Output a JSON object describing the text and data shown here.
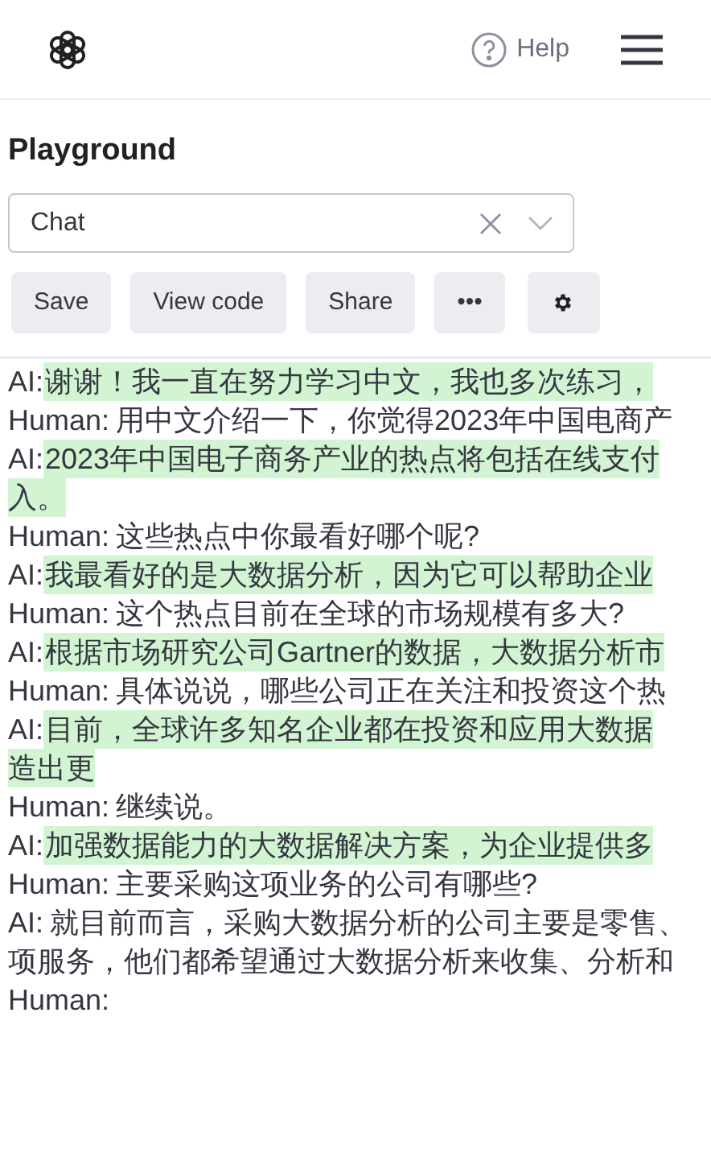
{
  "header": {
    "help": "Help"
  },
  "title": "Playground",
  "mode_select": {
    "value": "Chat"
  },
  "toolbar": [
    {
      "kind": "text",
      "label": "Save"
    },
    {
      "kind": "text",
      "label": "View code"
    },
    {
      "kind": "text",
      "label": "Share"
    },
    {
      "kind": "text",
      "label": "•••"
    },
    {
      "kind": "settings"
    }
  ],
  "messages": [
    {
      "speaker": "AI:",
      "highlighted": true,
      "lines": [
        "谢谢！我一直在努力学习中文，我也多次练习，"
      ]
    },
    {
      "speaker": "Human:",
      "highlighted": false,
      "lines": [
        "用中文介绍一下，你觉得2023年中国电商产"
      ]
    },
    {
      "speaker": "AI:",
      "highlighted": true,
      "lines": [
        "2023年中国电子商务产业的热点将包括在线支付",
        "入。"
      ]
    },
    {
      "speaker": "Human:",
      "highlighted": false,
      "lines": [
        "这些热点中你最看好哪个呢?"
      ]
    },
    {
      "speaker": "AI:",
      "highlighted": true,
      "lines": [
        "我最看好的是大数据分析，因为它可以帮助企业"
      ]
    },
    {
      "speaker": "Human:",
      "highlighted": false,
      "lines": [
        "这个热点目前在全球的市场规模有多大?"
      ]
    },
    {
      "speaker": "AI:",
      "highlighted": true,
      "lines": [
        "根据市场研究公司Gartner的数据，大数据分析市"
      ]
    },
    {
      "speaker": "Human:",
      "highlighted": false,
      "lines": [
        "具体说说，哪些公司正在关注和投资这个热"
      ]
    },
    {
      "speaker": "AI:",
      "highlighted": true,
      "lines": [
        "目前，全球许多知名企业都在投资和应用大数据",
        "造出更"
      ]
    },
    {
      "speaker": "Human:",
      "highlighted": false,
      "lines": [
        "继续说。"
      ]
    },
    {
      "speaker": "AI:",
      "highlighted": true,
      "lines": [
        "加强数据能力的大数据解决方案，为企业提供多"
      ]
    },
    {
      "speaker": "Human:",
      "highlighted": false,
      "lines": [
        "主要采购这项业务的公司有哪些?"
      ]
    },
    {
      "speaker": "AI:",
      "highlighted": false,
      "lines": [
        "就目前而言，采购大数据分析的公司主要是零售、",
        "项服务，他们都希望通过大数据分析来收集、分析和"
      ]
    },
    {
      "speaker": "Human:"
    }
  ]
}
